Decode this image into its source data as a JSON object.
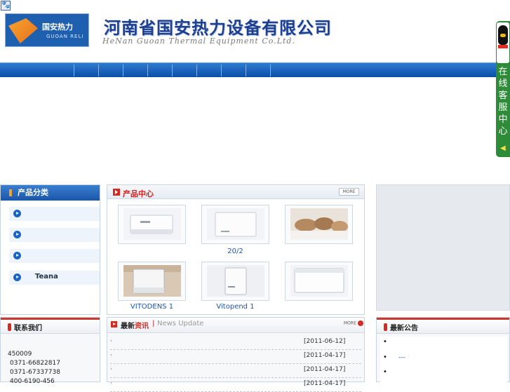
{
  "topbar": {
    "icon": "paw-icon",
    "glyph": "🐾"
  },
  "header": {
    "logo_text": "国安热力",
    "logo_sub": "GUOAN RELI",
    "company_name": "河南省国安热力设备有限公司",
    "company_name_en": "HeNan Guoan Thermal Equipment Co.Ltd."
  },
  "service": {
    "text": "在线客服中心"
  },
  "sidebar": {
    "title": "产品分类",
    "items": [
      {
        "label": ""
      },
      {
        "label": ""
      },
      {
        "label": ""
      },
      {
        "label": "Teana"
      }
    ]
  },
  "products": {
    "title": "产品中心",
    "more": "MORE",
    "items": [
      {
        "caption": ""
      },
      {
        "caption": "20/2"
      },
      {
        "caption": ""
      },
      {
        "caption": "VITODENS 1"
      },
      {
        "caption": "Vitopend 1"
      },
      {
        "caption": ""
      }
    ]
  },
  "contact": {
    "title": "联系我们",
    "lines": [
      "450009",
      "0371-66822817",
      "0371-67337738",
      "400-6190-456"
    ]
  },
  "news": {
    "title_a": "最新",
    "title_b": "资讯",
    "separator": "|",
    "title_en": "News Update",
    "more": "MORE",
    "rows": [
      {
        "bullet": "·",
        "date": "[2011-06-12]"
      },
      {
        "bullet": "·",
        "date": "[2011-04-17]"
      },
      {
        "bullet": "·",
        "date": "[2011-04-17]"
      },
      {
        "bullet": "·",
        "date": "[2011-04-17]"
      }
    ]
  },
  "notice": {
    "title": "最新公告",
    "items": [
      {
        "bullet": "•",
        "text": ""
      },
      {
        "bullet": "•",
        "text": "---"
      },
      {
        "bullet": "•",
        "text": ""
      }
    ]
  },
  "colors": {
    "nav": "#0b4fa8",
    "accent_red": "#d42a22",
    "service_green": "#2e8c38"
  }
}
